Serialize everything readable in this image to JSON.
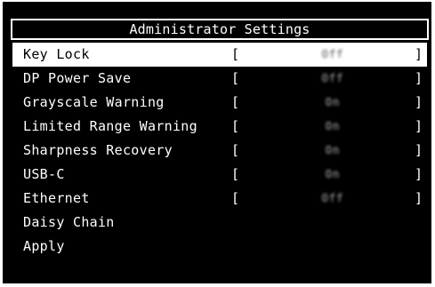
{
  "title": "Administrator Settings",
  "items": [
    {
      "label": "Key Lock",
      "value": "Off",
      "selected": true,
      "has_value": true
    },
    {
      "label": "DP Power Save",
      "value": "Off",
      "selected": false,
      "has_value": true
    },
    {
      "label": "Grayscale Warning",
      "value": "On",
      "selected": false,
      "has_value": true
    },
    {
      "label": "Limited Range Warning",
      "value": "On",
      "selected": false,
      "has_value": true
    },
    {
      "label": "Sharpness Recovery",
      "value": "On",
      "selected": false,
      "has_value": true
    },
    {
      "label": "USB-C",
      "value": "On",
      "selected": false,
      "has_value": true
    },
    {
      "label": "Ethernet",
      "value": "Off",
      "selected": false,
      "has_value": true
    },
    {
      "label": "Daisy Chain",
      "selected": false,
      "has_value": false
    },
    {
      "label": "Apply",
      "selected": false,
      "has_value": false
    }
  ],
  "brackets": {
    "open": "[",
    "close": "]"
  },
  "colors": {
    "background": "#000000",
    "foreground": "#ffffff",
    "highlight": "#ffffff"
  }
}
